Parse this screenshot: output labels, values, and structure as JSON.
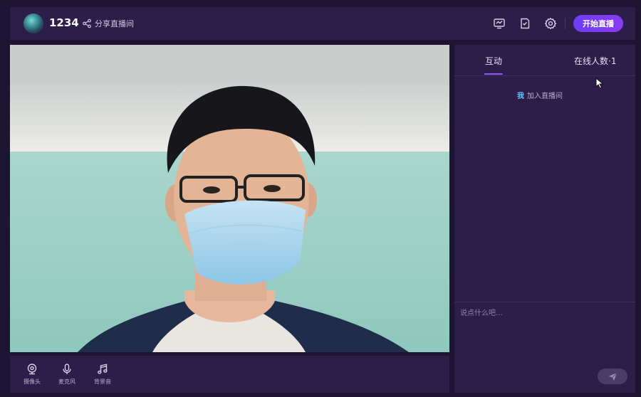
{
  "header": {
    "room_name": "1234",
    "share_label": "分享直播间",
    "icons": [
      "screen-icon",
      "checklist-icon",
      "gear-icon"
    ],
    "start_button": "开始直播"
  },
  "controls": [
    {
      "icon": "camera-icon",
      "label": "摄像头"
    },
    {
      "icon": "microphone-icon",
      "label": "麦克风"
    },
    {
      "icon": "music-icon",
      "label": "背景音"
    }
  ],
  "sidebar": {
    "tabs": [
      "互动",
      "在线人数·1"
    ],
    "active_tab": "互动",
    "messages": [
      {
        "user": "我",
        "text": "加入直播间"
      }
    ],
    "input_placeholder": "说点什么吧..."
  },
  "colors": {
    "accent": "#7c3cf5",
    "panel": "#2c1d49",
    "background": "#1d1433",
    "username": "#5fc6ff"
  }
}
